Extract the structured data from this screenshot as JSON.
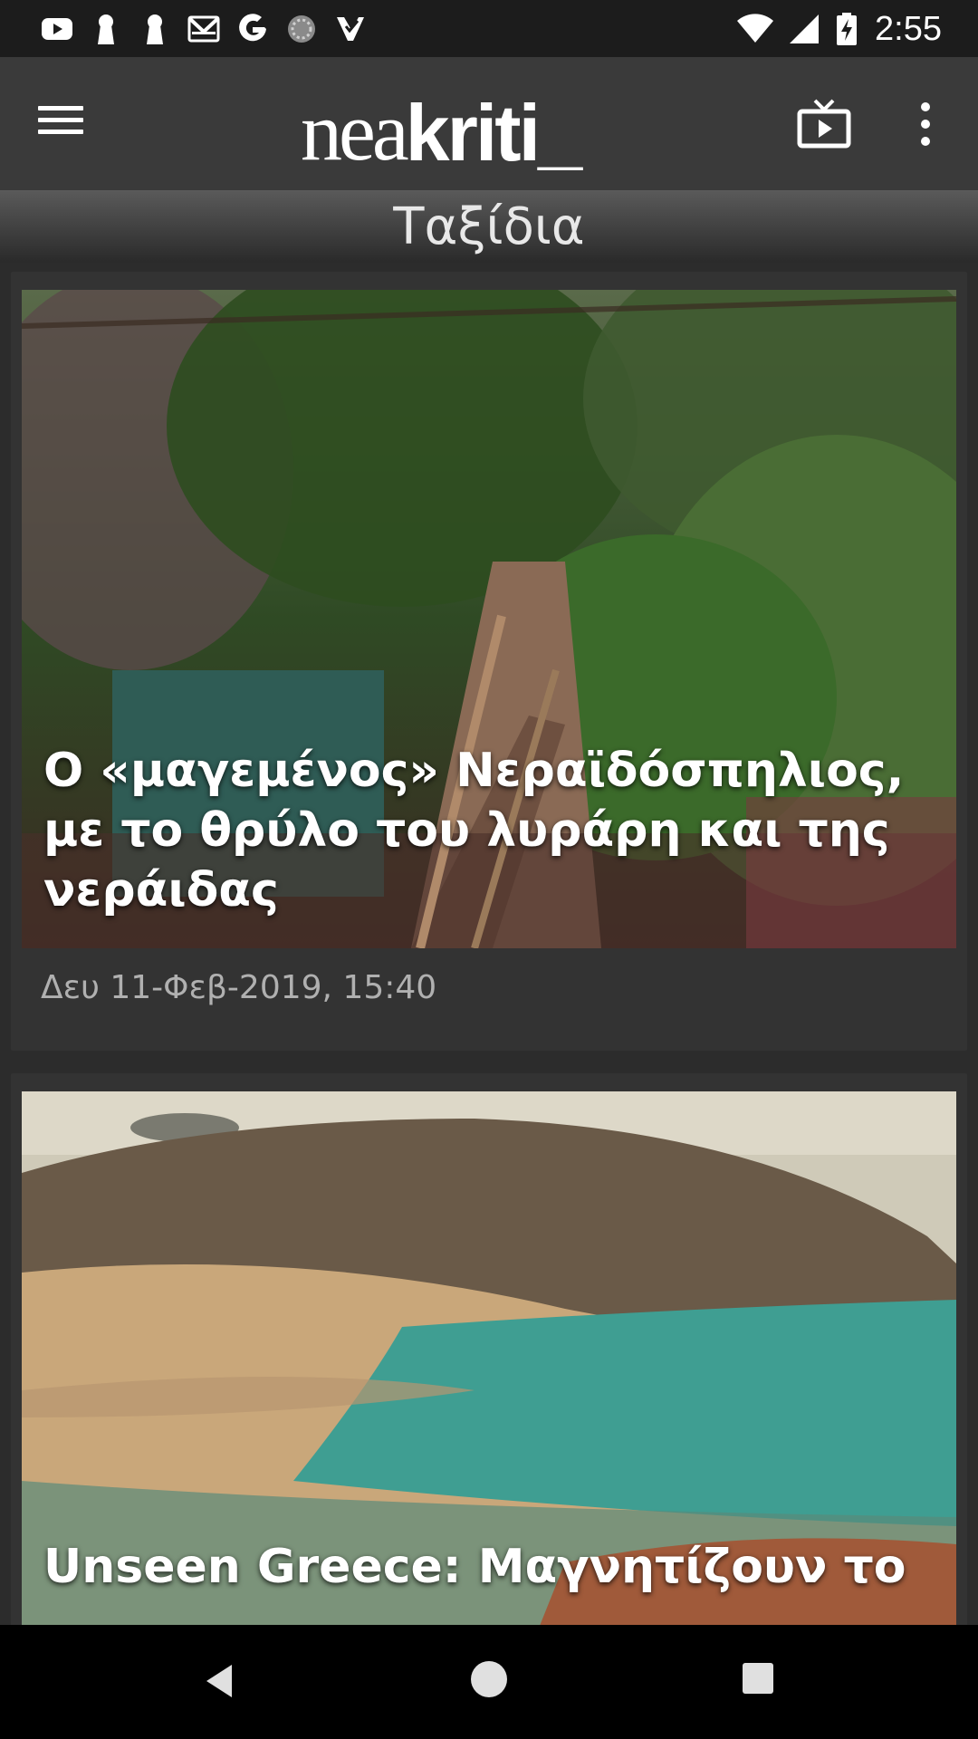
{
  "status_bar": {
    "time": "2:55",
    "left_icons": [
      "youtube-icon",
      "keyhole-icon",
      "keyhole-icon",
      "gmail-icon",
      "google-icon",
      "sync-icon",
      "inbox-check-icon"
    ],
    "right_icons": [
      "wifi-icon",
      "signal-icon",
      "battery-charging-icon"
    ]
  },
  "app_bar": {
    "logo_light": "nea",
    "logo_bold": "kriti_",
    "icons": [
      "menu-icon",
      "tv-icon",
      "more-vert-icon"
    ]
  },
  "section": {
    "title": "Ταξίδια"
  },
  "articles": [
    {
      "title": "Ο «μαγεμένος» Νεραϊδόσπηλιος, με το θρύλο του λυράρη και της νεράιδας",
      "date": "Δευ 11-Φεβ-2019,  15:40"
    },
    {
      "title": "Unseen Greece: Μαγνητίζουν το"
    }
  ],
  "nav_bar": {
    "icons": [
      "back-icon",
      "home-icon",
      "recents-icon"
    ]
  },
  "colors": {
    "status_bar": "#1c1c1c",
    "app_bar": "#3a3a3a",
    "card": "#333333",
    "background": "#2c2c2c"
  }
}
